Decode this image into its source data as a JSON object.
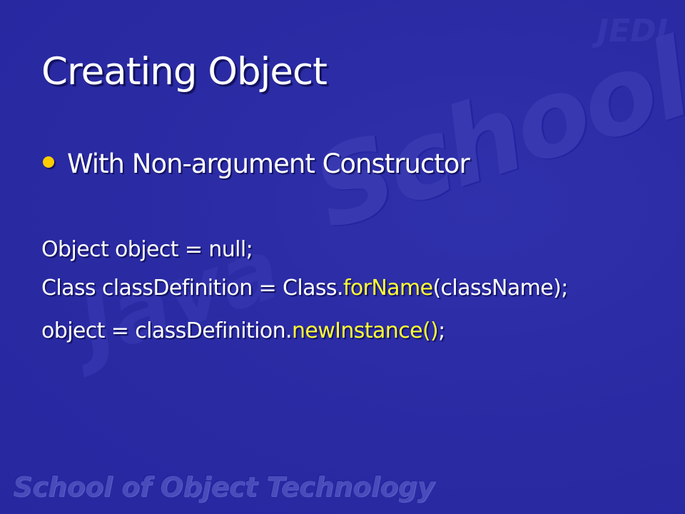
{
  "slide": {
    "title": "Creating Object",
    "bullet": {
      "text": "With Non-argument Constructor",
      "color": "#ffcc00"
    },
    "code": {
      "line1": "Object object = null;",
      "line2_prefix": "Class classDefinition = Class.",
      "line2_highlight": "forName",
      "line2_suffix": "(className);",
      "line3_prefix": "object = classDefinition.",
      "line3_highlight": "newInstance()",
      "line3_suffix": ";",
      "highlight_color": "#ffff33"
    },
    "watermark": {
      "main": "School",
      "secondary": "Java",
      "corner": "JEDI"
    },
    "footer": "School of Object Technology",
    "colors": {
      "background": "#2a2aa3",
      "text": "#ffffff"
    }
  }
}
